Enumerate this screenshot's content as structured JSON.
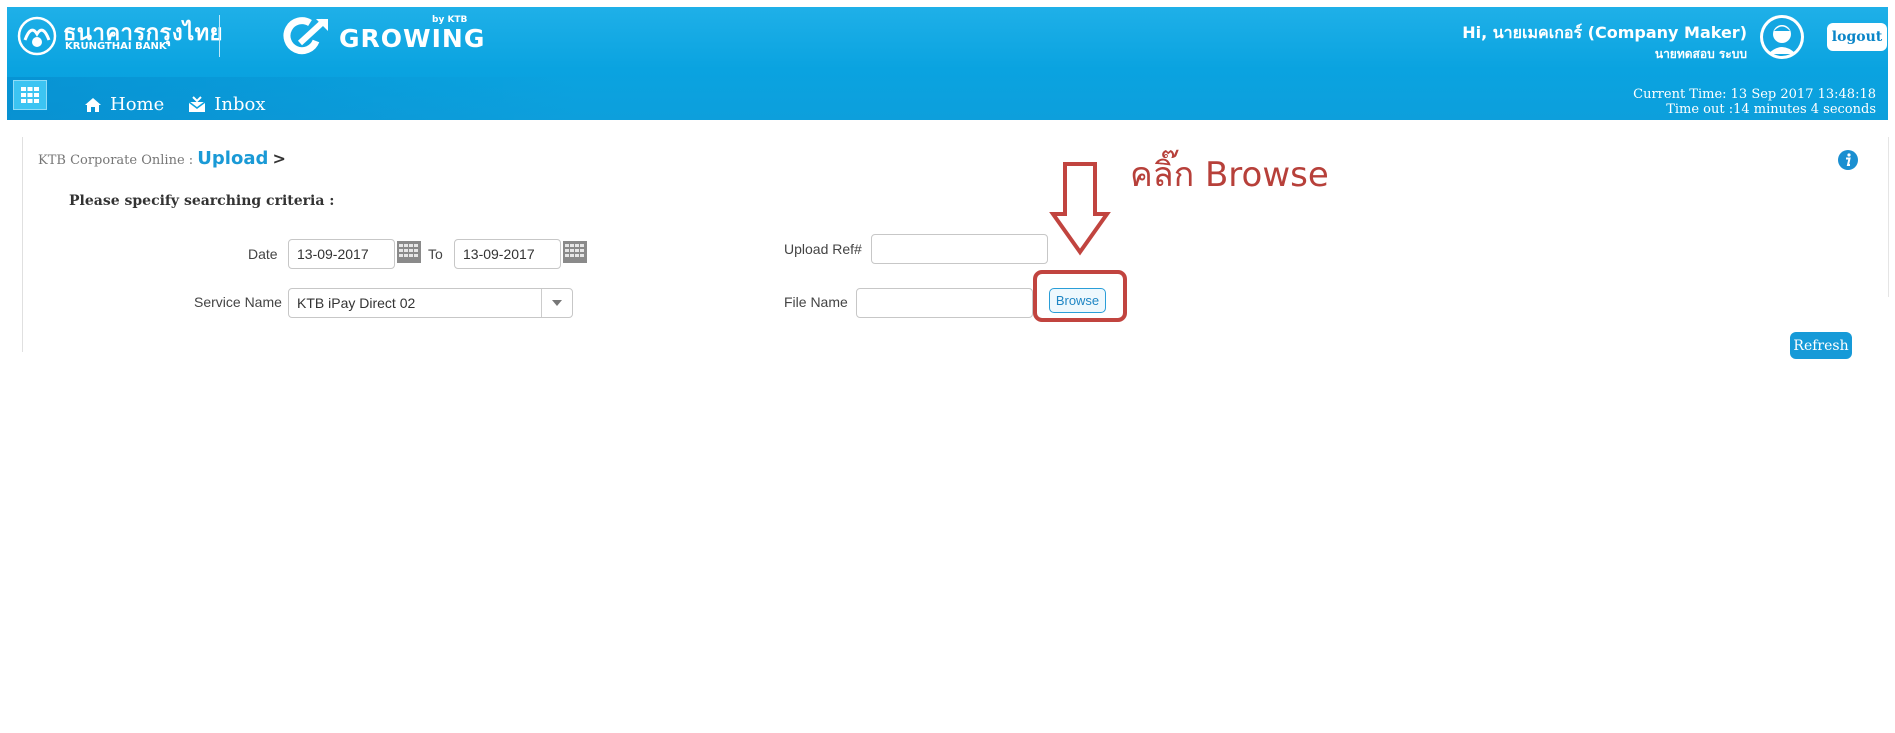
{
  "header": {
    "bank_name_thai": "ธนาคารกรุงไทย",
    "bank_name_en": "KRUNGTHAI BANK",
    "product_name": "GROWING",
    "product_by": "by KTB",
    "greeting": "Hi, นายเมคเกอร์ (Company Maker)",
    "user_subname": "นายทดสอบ ระบบ",
    "logout_label": "logout",
    "current_time": "Current Time: 13 Sep 2017 13:48:18",
    "timeout": "Time out :14 minutes 4 seconds"
  },
  "nav": {
    "home_label": "Home",
    "inbox_label": "Inbox"
  },
  "breadcrumb": {
    "root": "KTB Corporate Online :",
    "current": "Upload",
    "separator": ">"
  },
  "form": {
    "criteria_title": "Please specify searching criteria :",
    "date_label": "Date",
    "date_from": "13-09-2017",
    "to_label": "To",
    "date_to": "13-09-2017",
    "service_label": "Service Name",
    "service_value": "KTB iPay Direct 02",
    "upload_ref_label": "Upload Ref#",
    "upload_ref_value": "",
    "file_name_label": "File Name",
    "file_name_value": "",
    "browse_label": "Browse",
    "refresh_label": "Refresh"
  },
  "annotation": {
    "text": "คลิ๊ก Browse",
    "color": "#b7403a"
  },
  "colors": {
    "header_blue": "#0aa3e0",
    "accent": "#1a9ad6",
    "button_blue": "#169ad8"
  }
}
